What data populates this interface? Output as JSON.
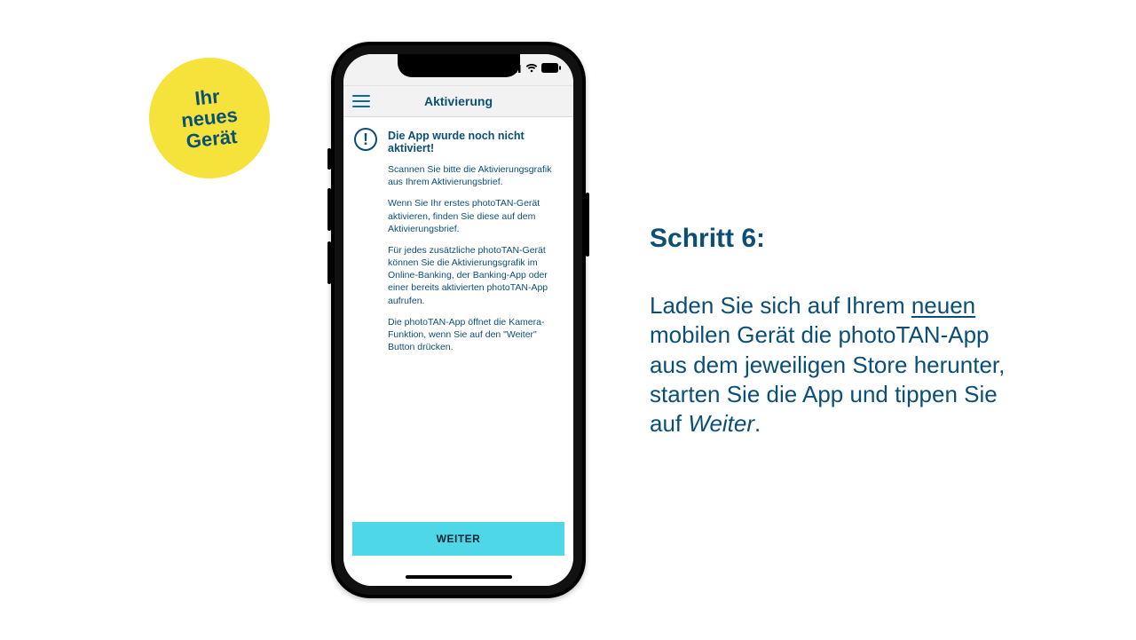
{
  "sticker": {
    "line1": "Ihr",
    "line2": "neues",
    "line3": "Gerät"
  },
  "phone": {
    "header": {
      "title": "Aktivierung"
    },
    "alert": {
      "icon_glyph": "!",
      "title": "Die App wurde noch nicht aktiviert!",
      "p1": "Scannen Sie bitte die Aktivierungsgrafik aus Ihrem Aktivierungsbrief.",
      "p2": "Wenn Sie Ihr erstes photoTAN-Gerät aktivieren, finden Sie diese auf dem Aktivierungsbrief.",
      "p3": "Für jedes zusätzliche photoTAN-Gerät können Sie die Aktivierungsgrafik im Online-Banking, der Banking-App oder einer bereits aktivierten photoTAN-App aufrufen.",
      "p4": "Die photoTAN-App öffnet die Kamera-Funktion, wenn Sie auf den \"Weiter\" Button drücken."
    },
    "cta_label": "WEITER"
  },
  "instructions": {
    "heading": "Schritt 6:",
    "body_1": "Laden Sie sich auf Ihrem ",
    "body_underlined": "neuen",
    "body_2": " mobilen Gerät die photoTAN-App aus dem jeweiligen Store herunter, starten Sie die App und tippen Sie auf ",
    "body_italic": "Weiter",
    "body_3": "."
  },
  "colors": {
    "brand_text": "#0b4f76",
    "sticker_bg": "#f5e23a",
    "cta_bg": "#4ed7e6"
  }
}
